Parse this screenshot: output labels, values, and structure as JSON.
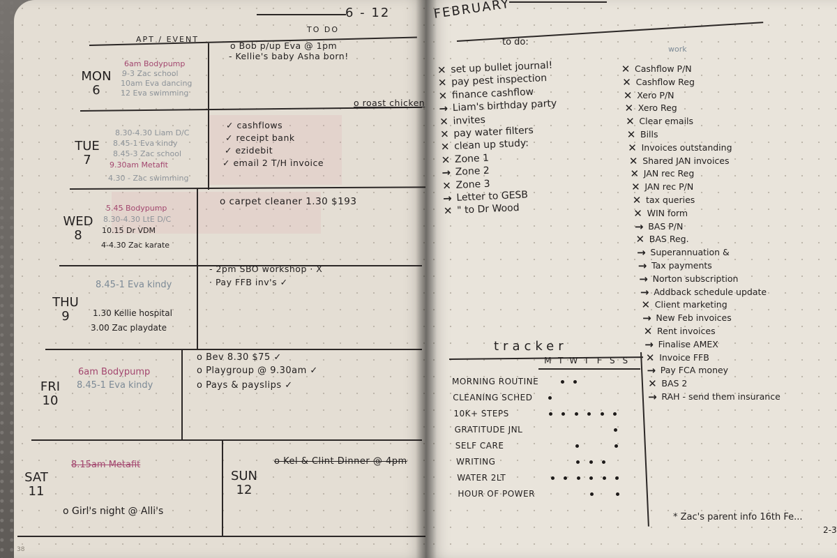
{
  "left_page": {
    "week_range": "6 - 12",
    "column_headers": {
      "appointments": "APT / EVENT",
      "todo": "TO DO"
    },
    "days": [
      {
        "day": "MON",
        "date": "6",
        "appointments": [
          {
            "text": "6am Bodypump",
            "ink": "pink",
            "struck": false
          },
          {
            "text": "9-3 Zac school",
            "ink": "grey",
            "struck": false
          },
          {
            "text": "10am Eva dancing",
            "ink": "grey",
            "struck": false
          },
          {
            "text": "12 Eva swimming",
            "ink": "grey",
            "struck": false
          }
        ],
        "todos": [
          {
            "text": "o Bob p/up Eva @ 1pm",
            "struck": false
          },
          {
            "text": "- Kellie's baby Asha born!",
            "struck": false
          },
          {
            "text": "o roast chicken",
            "struck": false
          }
        ]
      },
      {
        "day": "TUE",
        "date": "7",
        "appointments": [
          {
            "text": "8.30-4.30 Liam D/C",
            "ink": "grey",
            "struck": false
          },
          {
            "text": "8.45-1 Eva kindy",
            "ink": "grey",
            "struck": false
          },
          {
            "text": "8.45-3 Zac school",
            "ink": "grey",
            "struck": false
          },
          {
            "text": "9.30am Metafit",
            "ink": "pink",
            "struck": false
          },
          {
            "text": "4.30 - Zac swimming",
            "ink": "grey",
            "struck": false
          }
        ],
        "todos": [
          {
            "text": "✓ cashflows",
            "struck": false
          },
          {
            "text": "✓ receipt bank",
            "struck": false
          },
          {
            "text": "✓ ezidebit",
            "struck": false
          },
          {
            "text": "✓ email 2 T/H invoice",
            "struck": false
          }
        ]
      },
      {
        "day": "WED",
        "date": "8",
        "appointments": [
          {
            "text": "5.45 Bodypump",
            "ink": "pink",
            "struck": false
          },
          {
            "text": "8.30-4.30 LtE D/C",
            "ink": "grey",
            "struck": false
          },
          {
            "text": "10.15 Dr VDM",
            "ink": "black",
            "struck": false
          },
          {
            "text": "4-4.30 Zac karate",
            "ink": "black",
            "struck": false
          }
        ],
        "todos": [
          {
            "text": "o carpet cleaner 1.30 $193",
            "struck": false
          }
        ]
      },
      {
        "day": "THU",
        "date": "9",
        "appointments": [
          {
            "text": "8.45-1 Eva kindy",
            "ink": "blue",
            "struck": false
          },
          {
            "text": "1.30 Kellie hospital",
            "ink": "black",
            "struck": false
          },
          {
            "text": "3.00 Zac playdate",
            "ink": "black",
            "struck": false
          }
        ],
        "todos": [
          {
            "text": "- 2pm SBO workshop · X",
            "struck": false
          },
          {
            "text": "· Pay FFB inv's ✓",
            "struck": false
          }
        ]
      },
      {
        "day": "FRI",
        "date": "10",
        "appointments": [
          {
            "text": "6am Bodypump",
            "ink": "pink",
            "struck": false
          },
          {
            "text": "8.45-1 Eva kindy",
            "ink": "blue",
            "struck": false
          }
        ],
        "todos": [
          {
            "text": "o Bev 8.30 $75 ✓",
            "struck": false
          },
          {
            "text": "o Playgroup @ 9.30am ✓",
            "struck": false
          },
          {
            "text": "o Pays & payslips ✓",
            "struck": false
          }
        ]
      },
      {
        "day": "SAT",
        "date": "11",
        "appointments": [
          {
            "text": "8.15am Metafit",
            "ink": "pink",
            "struck": true
          },
          {
            "text": "o Girl's night @ Alli's",
            "ink": "black",
            "struck": false
          }
        ],
        "todos": []
      },
      {
        "day": "SUN",
        "date": "12",
        "appointments": [],
        "todos": [
          {
            "text": "o Kel & Clint Dinner @ 4pm",
            "struck": true
          }
        ]
      }
    ],
    "page_number": "38"
  },
  "right_page": {
    "month": "FEBRUARY",
    "todo_header": "to do:",
    "todos": [
      {
        "status": "done",
        "text": "set up bullet journal!"
      },
      {
        "status": "done",
        "text": "pay pest inspection"
      },
      {
        "status": "done",
        "text": "finance cashflow"
      },
      {
        "status": "migrated",
        "text": "Liam's birthday party"
      },
      {
        "status": "done",
        "text": "invites"
      },
      {
        "status": "done",
        "text": "pay water filters"
      },
      {
        "status": "done",
        "text": "clean up study:"
      },
      {
        "status": "done",
        "text": "Zone 1"
      },
      {
        "status": "migrated",
        "text": "Zone 2"
      },
      {
        "status": "done",
        "text": "Zone 3"
      },
      {
        "status": "migrated",
        "text": "Letter to GESB"
      },
      {
        "status": "done",
        "text": "\"   to Dr Wood"
      }
    ],
    "work_header": "work",
    "work": [
      {
        "status": "done",
        "text": "Cashflow P/N"
      },
      {
        "status": "done",
        "text": "Cashflow Reg"
      },
      {
        "status": "done",
        "text": "Xero P/N"
      },
      {
        "status": "done",
        "text": "Xero Reg"
      },
      {
        "status": "done",
        "text": "Clear emails"
      },
      {
        "status": "done",
        "text": "Bills"
      },
      {
        "status": "done",
        "text": "Invoices outstanding"
      },
      {
        "status": "done",
        "text": "Shared JAN invoices"
      },
      {
        "status": "done",
        "text": "JAN rec Reg"
      },
      {
        "status": "done",
        "text": "JAN rec P/N"
      },
      {
        "status": "done",
        "text": "tax queries"
      },
      {
        "status": "done",
        "text": "WIN form"
      },
      {
        "status": "migrated",
        "text": "BAS P/N"
      },
      {
        "status": "done",
        "text": "BAS Reg."
      },
      {
        "status": "migrated",
        "text": "Superannuation &"
      },
      {
        "status": "migrated",
        "text": "Tax payments"
      },
      {
        "status": "migrated",
        "text": "Norton subscription"
      },
      {
        "status": "migrated",
        "text": "Addback schedule update"
      },
      {
        "status": "done",
        "text": "Client marketing"
      },
      {
        "status": "migrated",
        "text": "New Feb invoices"
      },
      {
        "status": "done",
        "text": "Rent invoices"
      },
      {
        "status": "migrated",
        "text": "Finalise AMEX"
      },
      {
        "status": "done",
        "text": "Invoice FFB"
      },
      {
        "status": "migrated",
        "text": "Pay FCA money"
      },
      {
        "status": "done",
        "text": "BAS 2"
      },
      {
        "status": "migrated",
        "text": "RAH - send them insurance"
      }
    ],
    "bullet_glyphs": {
      "done": "✕",
      "migrated": "→"
    },
    "tracker": {
      "title": "tracker",
      "days": [
        "M",
        "T",
        "W",
        "T",
        "F",
        "S",
        "S"
      ],
      "habits": [
        {
          "name": "MORNING ROUTINE",
          "done": [
            false,
            true,
            true,
            false,
            false,
            false,
            false
          ]
        },
        {
          "name": "CLEANING SCHED",
          "done": [
            true,
            false,
            false,
            false,
            false,
            false,
            false
          ]
        },
        {
          "name": "10K+ STEPS",
          "done": [
            true,
            true,
            true,
            true,
            true,
            true,
            false
          ]
        },
        {
          "name": "GRATITUDE JNL",
          "done": [
            false,
            false,
            false,
            false,
            false,
            true,
            false
          ]
        },
        {
          "name": "SELF CARE",
          "done": [
            false,
            false,
            true,
            false,
            false,
            true,
            false
          ]
        },
        {
          "name": "WRITING",
          "done": [
            false,
            false,
            true,
            true,
            true,
            false,
            false
          ]
        },
        {
          "name": "WATER 2LT",
          "done": [
            true,
            true,
            true,
            true,
            true,
            true,
            false
          ]
        },
        {
          "name": "HOUR OF POWER",
          "done": [
            false,
            false,
            false,
            true,
            false,
            true,
            false
          ]
        }
      ]
    },
    "footer_note": "* Zac's parent info 16th Fe...",
    "footer_note_sub": "2-3"
  }
}
